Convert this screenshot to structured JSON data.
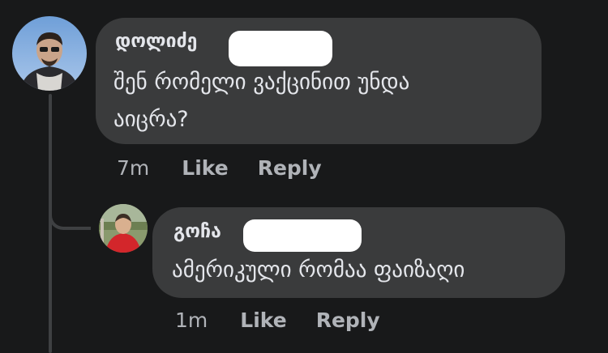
{
  "comments": [
    {
      "author": "დოლიძე",
      "text_line1": "შენ რომელი ვაქცინით უნდა",
      "text_line2": "აიცრა?",
      "time": "7m",
      "like_label": "Like",
      "reply_label": "Reply"
    },
    {
      "author": "გოჩა",
      "text_line1": "ამერიკული რომაა ფაიზაღი",
      "time": "1m",
      "like_label": "Like",
      "reply_label": "Reply"
    }
  ],
  "colors": {
    "background": "#18191a",
    "bubble": "#3a3b3c",
    "text": "#e4e6eb",
    "secondary_text": "#b0b3b8",
    "thread_line": "#3e4042"
  }
}
